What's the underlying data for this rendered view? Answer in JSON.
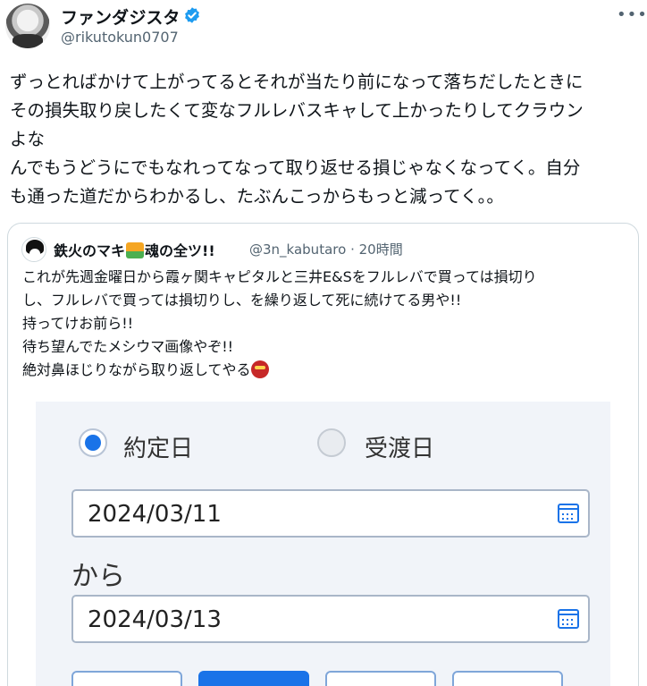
{
  "author": {
    "display_name": "ファンダジスタ",
    "handle": "@rikutokun0707",
    "verified": true
  },
  "tweet": {
    "text": "ずっとればかけて上がってるとそれが当たり前になって落ちだしたときに\nその損失取り戻したくて変なフルレバスキャして上かったりしてクラウン\nよな\nんでもうどうにでもなれってなって取り返せる損じゃなくなってく。自分\nも通った道だからわかるし、たぶんこっからもっと減ってく。。"
  },
  "quote": {
    "name_part1": "鉄火のマキ",
    "name_part2": "魂の全ツ!!",
    "handle": "@3n_kabutaro",
    "separator": "·",
    "time": "20時間",
    "text_lines": [
      "これが先週金曜日から霞ヶ関キャピタルと三井E&Sをフルレバで買っては損切り",
      "し、フルレバで買っては損切りし、を繰り返して死に続けてる男や!!",
      "持ってけお前ら!!",
      "待ち望んでたメシウマ画像やぞ!!",
      "絶対鼻ほじりながら取り返してやる"
    ],
    "image": {
      "radio_selected_label": "約定日",
      "radio_unselected_label": "受渡日",
      "date_from": "2024/03/11",
      "range_label": "から",
      "date_to": "2024/03/13"
    }
  },
  "icons": {
    "verified": "verified-badge-icon",
    "more": "more-options-icon",
    "calendar": "calendar-icon",
    "emoji_sunrise": "sunrise-emoji",
    "emoji_ogre": "ogre-emoji"
  },
  "colors": {
    "verified_blue": "#1d9bf0",
    "text": "#0f1419",
    "secondary": "#536471",
    "border": "#cfd9de",
    "accent": "#1a73e8"
  }
}
